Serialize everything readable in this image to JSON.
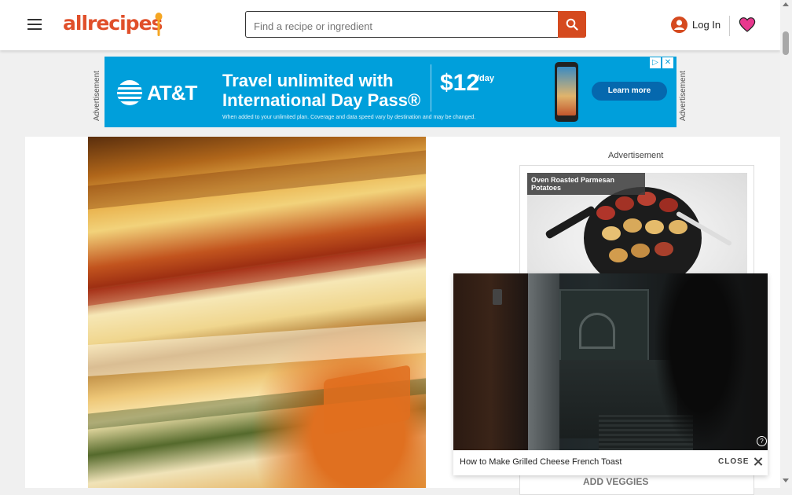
{
  "header": {
    "logo_text": "allrecipes",
    "search_placeholder": "Find a recipe or ingredient",
    "login_label": "Log In"
  },
  "top_ad": {
    "side_label": "Advertisement",
    "brand": "AT&T",
    "headline_line1": "Travel unlimited with",
    "headline_line2": "International Day Pass®",
    "price": "$12",
    "price_unit": "/day",
    "cta": "Learn more",
    "fine_print": "When added to your unlimited plan. Coverage and data speed vary by destination and may be changed."
  },
  "right_rail": {
    "ad_label": "Advertisement",
    "card_title": "Oven Roasted Parmesan Potatoes",
    "next_label": "ADD VEGGIES"
  },
  "video": {
    "title": "How to Make Grilled Cheese French Toast",
    "close_label": "CLOSE",
    "help_label": "?"
  },
  "colors": {
    "brand_orange": "#e04f2a",
    "search_button": "#d54a1f",
    "att_blue": "#009fdb",
    "heart_pink": "#e8378e"
  }
}
